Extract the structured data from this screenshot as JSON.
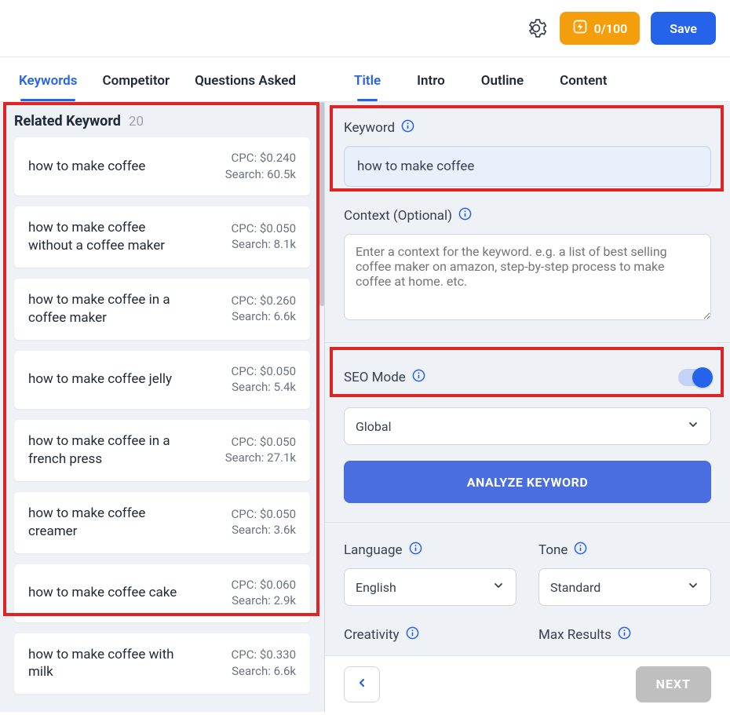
{
  "topbar": {
    "usage_text": "0/100",
    "save_label": "Save"
  },
  "tabs_left": [
    {
      "label": "Keywords",
      "active": true
    },
    {
      "label": "Competitor",
      "active": false
    },
    {
      "label": "Questions Asked",
      "active": false
    }
  ],
  "tabs_right": [
    {
      "label": "Title",
      "active": true
    },
    {
      "label": "Intro",
      "active": false
    },
    {
      "label": "Outline",
      "active": false
    },
    {
      "label": "Content",
      "active": false
    }
  ],
  "related": {
    "title": "Related Keyword",
    "count": "20",
    "items": [
      {
        "term": "how to make coffee",
        "cpc": "CPC: $0.240",
        "search": "Search: 60.5k"
      },
      {
        "term": "how to make coffee without a coffee maker",
        "cpc": "CPC: $0.050",
        "search": "Search: 8.1k"
      },
      {
        "term": "how to make coffee in a coffee maker",
        "cpc": "CPC: $0.260",
        "search": "Search: 6.6k"
      },
      {
        "term": "how to make coffee jelly",
        "cpc": "CPC: $0.050",
        "search": "Search: 5.4k"
      },
      {
        "term": "how to make coffee in a french press",
        "cpc": "CPC: $0.050",
        "search": "Search: 27.1k"
      },
      {
        "term": "how to make coffee creamer",
        "cpc": "CPC: $0.050",
        "search": "Search: 3.6k"
      },
      {
        "term": "how to make coffee cake",
        "cpc": "CPC: $0.060",
        "search": "Search: 2.9k"
      },
      {
        "term": "how to make coffee with milk",
        "cpc": "CPC: $0.330",
        "search": "Search: 6.6k"
      }
    ]
  },
  "form": {
    "keyword_label": "Keyword",
    "keyword_value": "how to make coffee",
    "context_label": "Context (Optional)",
    "context_placeholder": "Enter a context for the keyword. e.g. a list of best selling coffee maker on amazon, step-by-step process to make coffee at home. etc.",
    "seo_label": "SEO Mode",
    "region_value": "Global",
    "analyze_label": "ANALYZE KEYWORD",
    "language_label": "Language",
    "language_value": "English",
    "tone_label": "Tone",
    "tone_value": "Standard",
    "creativity_label": "Creativity",
    "max_results_label": "Max Results"
  },
  "footer": {
    "next_label": "NEXT"
  }
}
